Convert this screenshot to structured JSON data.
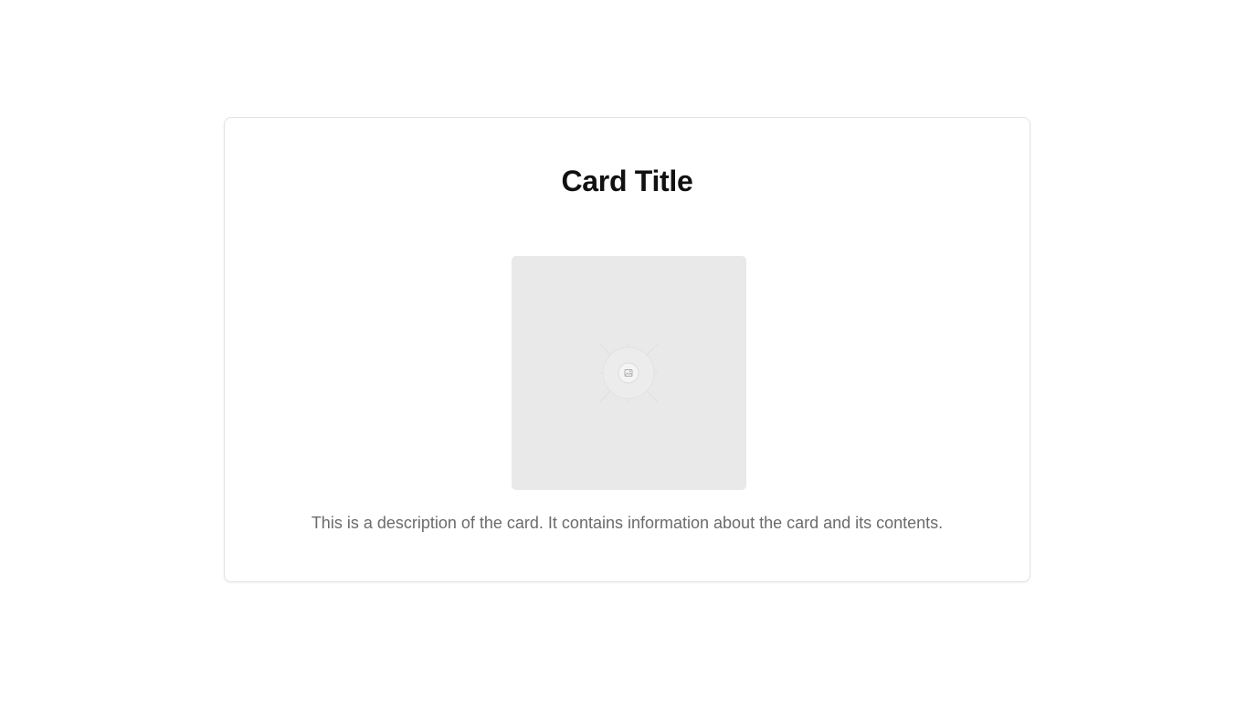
{
  "card": {
    "title": "Card Title",
    "image": {
      "icon": "image-icon",
      "background": "#e9e9e9"
    },
    "description": "This is a description of the card. It contains information about the card and its contents."
  }
}
